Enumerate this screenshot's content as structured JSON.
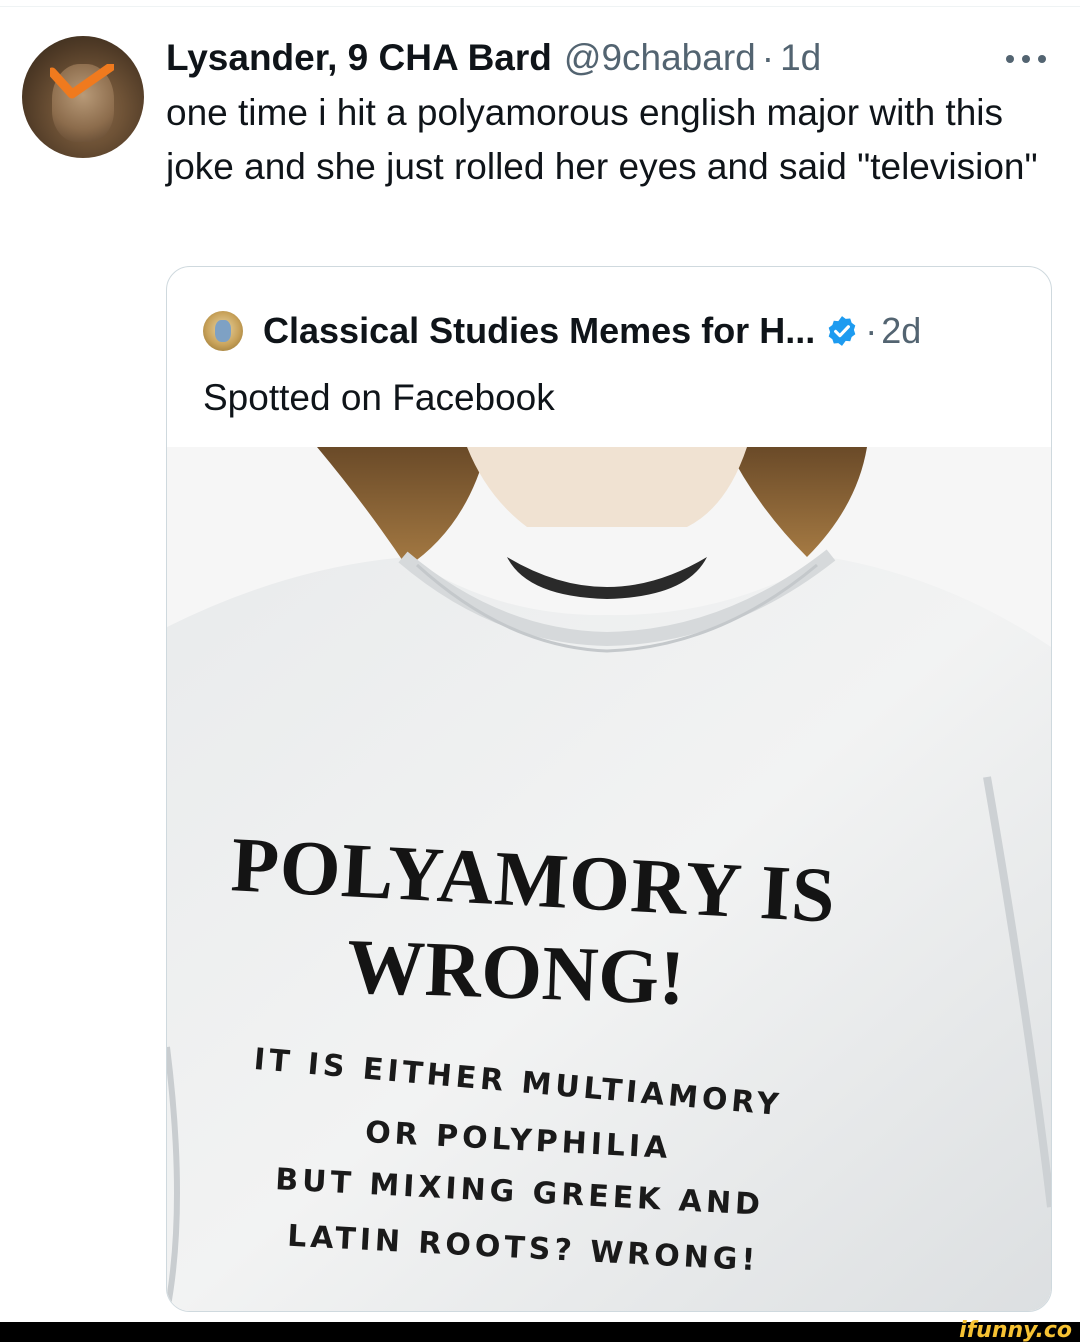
{
  "tweet": {
    "author_name": "Lysander, 9 CHA Bard",
    "handle": "@9chabard",
    "separator": "·",
    "time": "1d",
    "text": "one time i hit a polyamorous english major with this joke and she just rolled her eyes and said \"television\""
  },
  "quoted": {
    "author_name": "Classical Studies Memes for H...",
    "separator": "·",
    "time": "2d",
    "verified": true,
    "text": "Spotted on Facebook"
  },
  "shirt": {
    "line1": "POLYAMORY IS",
    "line2": "WRONG!",
    "line3": "IT IS EITHER MULTIAMORY",
    "line4": "OR POLYPHILIA",
    "line5": "BUT MIXING GREEK AND",
    "line6": "LATIN ROOTS? WRONG!"
  },
  "watermark": "ifunny.co",
  "colors": {
    "text": "#0f1419",
    "muted": "#536471",
    "border": "#cfd9de",
    "verified": "#1d9bf0",
    "watermark": "#f6c233"
  },
  "icons": [
    "more-icon",
    "verified-badge-icon"
  ]
}
